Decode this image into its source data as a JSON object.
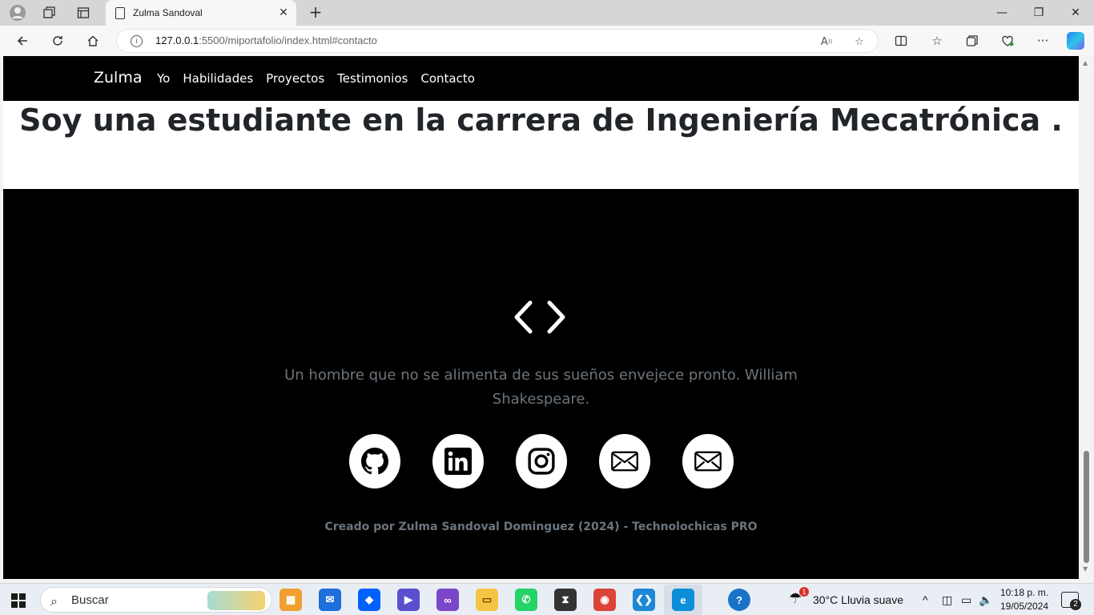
{
  "browser": {
    "tab_title": "Zulma Sandoval",
    "url_host": "127.0.0.1",
    "url_rest": ":5500/miportafolio/index.html#contacto"
  },
  "page": {
    "brand": "Zulma",
    "nav_links": [
      "Yo",
      "Habilidades",
      "Proyectos",
      "Testimonios",
      "Contacto"
    ],
    "headline": "Soy una estudiante en la carrera de Ingeniería Mecatrónica .",
    "quote": "Un hombre que no se alimenta de sus sueños envejece pronto. William Shakespeare.",
    "social_icons": [
      "github-icon",
      "linkedin-icon",
      "instagram-icon",
      "email-icon",
      "email-icon"
    ],
    "credit": "Creado por Zulma Sandoval Dominguez (2024) - Technolochicas PRO"
  },
  "taskbar": {
    "search_placeholder": "Buscar",
    "weather": "30°C  Lluvia suave",
    "weather_badge": "1",
    "time": "10:18 p. m.",
    "date": "19/05/2024",
    "notification_count": "2"
  },
  "colors": {
    "navbar_bg": "#000000",
    "footer_bg": "#000000",
    "muted_text": "#6c757d",
    "headline_text": "#212529"
  }
}
